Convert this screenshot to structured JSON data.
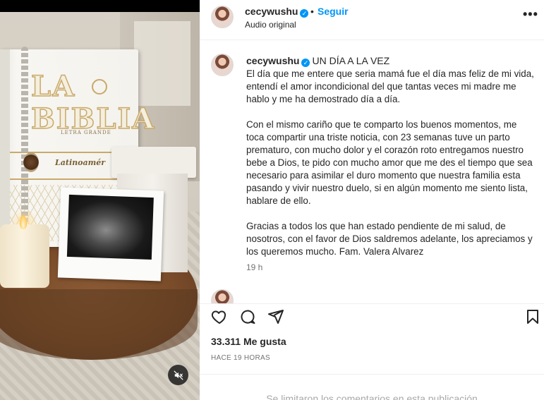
{
  "post": {
    "username": "cecywushu",
    "follow_label": "Seguir",
    "separator": "•",
    "audio": "Audio original",
    "more_label": "•••"
  },
  "caption": {
    "username": "cecywushu",
    "title": "UN DÍA A LA VEZ",
    "body": "El día que me entere que seria mamá fue el día mas feliz de mi vida, entendí el amor incondicional del que tantas veces mi madre me hablo y me ha demostrado día a día.\n\nCon el mismo cariño que te comparto los buenos momentos, me toca compartir una triste noticia, con 23 semanas tuve un parto prematuro, con mucho dolor y el corazón roto entregamos nuestro bebe a Dios, te pido con mucho amor que me des el tiempo que sea necesario para asimilar el duro momento que nuestra familia esta pasando y vivir nuestro duelo, si en algún momento me siento lista, hablare de ello.\n\nGracias a todos los que han estado pendiente de mi salud, de nosotros, con el favor de Dios saldremos adelante, los apreciamos y los queremos mucho. Fam. Valera Alvarez",
    "time": "19 h"
  },
  "media": {
    "bible_title": "LA BIBLIA",
    "bible_sub": "LETRA GRANDE",
    "bible_edition": "Latinoamér"
  },
  "stats": {
    "likes": "33.311 Me gusta",
    "posted": "HACE 19 HORAS"
  },
  "comments": {
    "limited": "Se limitaron los comentarios en esta publicación"
  },
  "icons": {
    "like": "heart-icon",
    "comment": "comment-icon",
    "share": "share-icon",
    "save": "bookmark-icon",
    "mute": "audio-muted-icon",
    "verified": "verified-badge-icon",
    "more": "more-options-icon"
  },
  "colors": {
    "link": "#0095f6",
    "verified": "#0095f6",
    "text": "#262626",
    "secondary": "#737373"
  }
}
